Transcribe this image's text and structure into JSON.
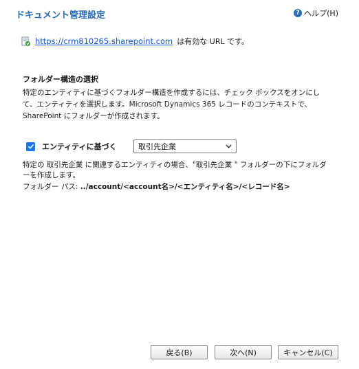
{
  "dialog": {
    "title": "ドキュメント管理設定",
    "help_label": "ヘルプ(H)",
    "help_icon": "question-circle-icon"
  },
  "url_check": {
    "icon": "document-icon",
    "url": "https://crm810265.sharepoint.com",
    "suffix": "は有効な URL です。"
  },
  "folder_structure": {
    "heading": "フォルダー構造の選択",
    "description": "特定のエンティティに基づくフォルダー構造を作成するには、チェック ボックスをオンにして、エンティティを選択します。Microsoft Dynamics 365 レコードのコンテキストで、SharePoint にフォルダーが作成されます。",
    "entity_checkbox_checked": true,
    "entity_label": "エンティティに基づく",
    "entity_select_value": "取引先企業",
    "folder_description": "特定の 取引先企業 に関連するエンティティの場合、\"取引先企業 \" フォルダーの下にフォルダーを作成します。",
    "folder_path_label": "フォルダー パス: ",
    "folder_path_value": "../account/<account名>/<エンティティ名>/<レコード名>"
  },
  "buttons": {
    "back": "戻る(B)",
    "next": "次へ(N)",
    "cancel": "キャンセル(C)"
  },
  "colors": {
    "title": "#2a6db5",
    "link": "#1155cc",
    "checkbox": "#1a73e8"
  }
}
